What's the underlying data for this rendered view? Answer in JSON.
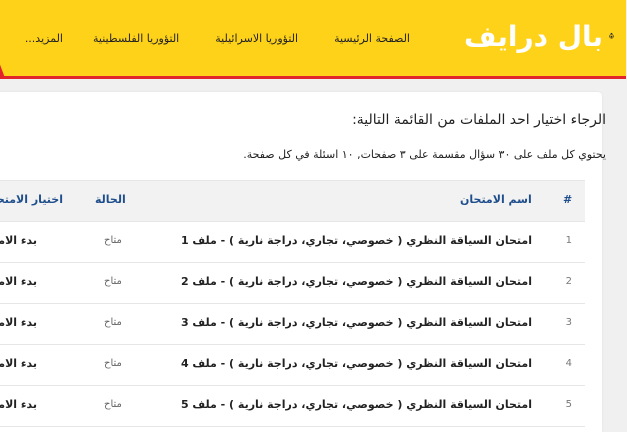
{
  "header": {
    "logo_text": "بال درايف",
    "nav": [
      {
        "label": "الصفحة الرئيسية"
      },
      {
        "label": "التؤوريا الاسرائيلية"
      },
      {
        "label": "التؤوريا الفلسطينية"
      },
      {
        "label": "المزيد..."
      }
    ]
  },
  "main": {
    "title": "الرجاء اختيار احد الملفات من القائمة التالية:",
    "description": "يحتوي كل ملف على ٣٠ سؤال مقسمة على ٣ صفحات, ١٠ اسئلة في كل صفحة.",
    "table": {
      "headers": {
        "num": "#",
        "name": "اسم الامتحان",
        "status": "الحالة",
        "choose": "اختيار الامتحان"
      },
      "rows": [
        {
          "num": "1",
          "name": "امتحان السياقة النظري ( خصوصي، تجاري، دراجة نارية ) - ملف 1",
          "status": "متاح",
          "action": "بدء الامتحان"
        },
        {
          "num": "2",
          "name": "امتحان السياقة النظري ( خصوصي، تجاري، دراجة نارية ) - ملف 2",
          "status": "متاح",
          "action": "بدء الامتحان"
        },
        {
          "num": "3",
          "name": "امتحان السياقة النظري ( خصوصي، تجاري، دراجة نارية ) - ملف 3",
          "status": "متاح",
          "action": "بدء الامتحان"
        },
        {
          "num": "4",
          "name": "امتحان السياقة النظري ( خصوصي، تجاري، دراجة نارية ) - ملف 4",
          "status": "متاح",
          "action": "بدء الامتحان"
        },
        {
          "num": "5",
          "name": "امتحان السياقة النظري ( خصوصي، تجاري، دراجة نارية ) - ملف 5",
          "status": "متاح",
          "action": "بدء الامتحان"
        }
      ]
    }
  },
  "colors": {
    "header_bg": "#ffd21a",
    "accent_red": "#e2252b",
    "header_text": "#1f4e8c"
  },
  "icons": {
    "logo": "steering-wheel-icon"
  }
}
